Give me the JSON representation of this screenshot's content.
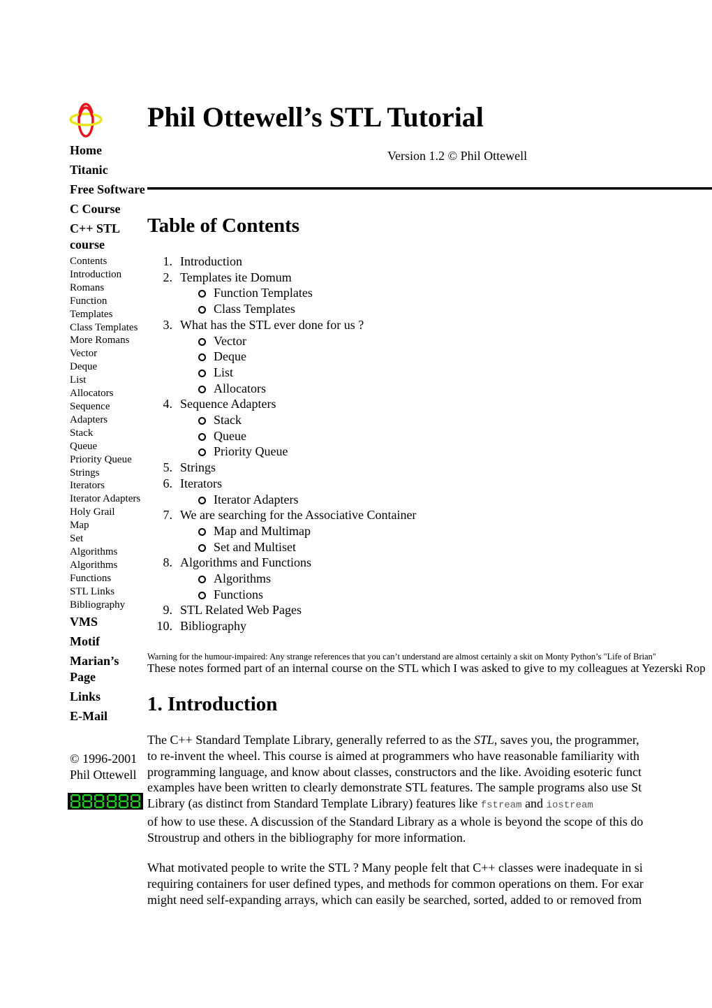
{
  "sidebar": {
    "nav_top": [
      {
        "label": "Home"
      },
      {
        "label": "Titanic"
      },
      {
        "label": "Free Software"
      },
      {
        "label": "C Course"
      },
      {
        "label": "C++ STL course"
      }
    ],
    "nav_course": [
      {
        "label": "Contents"
      },
      {
        "label": "Introduction"
      },
      {
        "label": "Romans"
      },
      {
        "label": "Function Templates"
      },
      {
        "label": "Class Templates"
      },
      {
        "label": "More Romans"
      },
      {
        "label": "Vector"
      },
      {
        "label": "Deque"
      },
      {
        "label": "List"
      },
      {
        "label": "Allocators"
      },
      {
        "label": "Sequence Adapters"
      },
      {
        "label": "Stack"
      },
      {
        "label": "Queue"
      },
      {
        "label": "Priority Queue"
      },
      {
        "label": "Strings"
      },
      {
        "label": "Iterators"
      },
      {
        "label": "Iterator Adapters"
      },
      {
        "label": "Holy Grail"
      },
      {
        "label": "Map"
      },
      {
        "label": "Set"
      },
      {
        "label": "Algorithms"
      },
      {
        "label": "Algorithms"
      },
      {
        "label": "Functions"
      },
      {
        "label": "STL Links"
      },
      {
        "label": "Bibliography"
      }
    ],
    "nav_bottom": [
      {
        "label": "VMS"
      },
      {
        "label": "Motif"
      },
      {
        "label": "Marian’s Page"
      },
      {
        "label": "Links"
      },
      {
        "label": "E-Mail"
      }
    ],
    "copyright": "© 1996-2001 Phil Ottewell",
    "counter_digits": "888888",
    "counter_color": "#22cc22"
  },
  "header": {
    "title": "Phil Ottewell’s STL Tutorial",
    "version": "Version 1.2 © Phil Ottewell"
  },
  "toc": {
    "heading": "Table of Contents",
    "items": [
      {
        "num": "1.",
        "label": "Introduction",
        "subs": []
      },
      {
        "num": "2.",
        "label": "Templates ite Domum",
        "subs": [
          "Function Templates",
          "Class Templates"
        ]
      },
      {
        "num": "3.",
        "label": "What has the STL ever done for us ?",
        "subs": [
          "Vector",
          "Deque",
          "List",
          "Allocators"
        ]
      },
      {
        "num": "4.",
        "label": "Sequence Adapters",
        "subs": [
          "Stack",
          "Queue",
          "Priority Queue"
        ]
      },
      {
        "num": "5.",
        "label": "Strings",
        "subs": []
      },
      {
        "num": "6.",
        "label": "Iterators",
        "subs": [
          "Iterator Adapters"
        ]
      },
      {
        "num": "7.",
        "label": "We are searching for the Associative Container",
        "subs": [
          "Map and Multimap",
          "Set and Multiset"
        ]
      },
      {
        "num": "8.",
        "label": "Algorithms and Functions",
        "subs": [
          "Algorithms",
          "Functions"
        ]
      },
      {
        "num": "9.",
        "label": "STL Related Web Pages",
        "subs": []
      },
      {
        "num": "10.",
        "label": "Bibliography",
        "subs": []
      }
    ]
  },
  "warning": "Warning for the humour-impaired: Any strange references that you can’t understand are almost certainly a skit on Monty Python’s \"Life of Brian\"",
  "notes": "These notes formed part of an internal course on the STL which I was asked to give to my colleagues at Yezerski Rop",
  "intro": {
    "heading": "1. Introduction",
    "p1": {
      "l1a": "The C++ Standard Template Library, generally referred to as the ",
      "l1em": "STL",
      "l1b": ", saves you, the programmer,",
      "l2": "to re-invent the wheel. This course is aimed at programmers who have reasonable familiarity with",
      "l3": "programming language, and know about classes, constructors and the like. Avoiding esoteric funct",
      "l4": "examples have been written to clearly demonstrate STL features. The sample programs also use St",
      "l5a": "Library (as distinct from Standard Template Library) features like ",
      "l5code1": "fstream",
      "l5b": " and ",
      "l5code2": "iostream",
      "l6": "of how to use these. A discussion of the Standard Library as a whole is beyond the scope of this do",
      "l7": "Stroustrup and others in the bibliography for more information."
    },
    "p2": {
      "l1": "What motivated people to write the STL ? Many people felt that C++ classes were inadequate in si",
      "l2": "requiring containers for user defined types, and methods for common operations on them. For exar",
      "l3": "might need self-expanding arrays, which can easily be searched, sorted, added to or removed from"
    }
  }
}
